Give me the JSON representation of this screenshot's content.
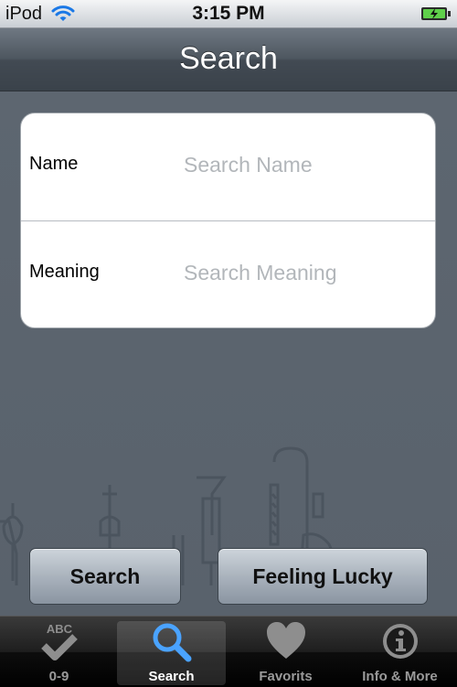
{
  "status_bar": {
    "carrier": "iPod",
    "time": "3:15 PM",
    "wifi_icon": "wifi-icon",
    "battery_icon": "battery-charging-icon"
  },
  "nav_bar": {
    "title": "Search"
  },
  "form": {
    "name": {
      "label": "Name",
      "placeholder": "Search Name",
      "value": ""
    },
    "meaning": {
      "label": "Meaning",
      "placeholder": "Search Meaning",
      "value": ""
    }
  },
  "buttons": {
    "search": "Search",
    "feeling_lucky": "Feeling Lucky"
  },
  "tab_bar": {
    "selected_index": 1,
    "items": [
      {
        "label": "0-9",
        "icon": "abc-check-icon"
      },
      {
        "label": "Search",
        "icon": "magnifier-icon"
      },
      {
        "label": "Favorits",
        "icon": "heart-icon"
      },
      {
        "label": "Info & More",
        "icon": "info-icon"
      }
    ]
  },
  "colors": {
    "background": "#56606b",
    "nav_bar": "#4e5760",
    "tab_selected_icon": "#4aa3ff",
    "tab_icon": "#8e8e8e"
  }
}
